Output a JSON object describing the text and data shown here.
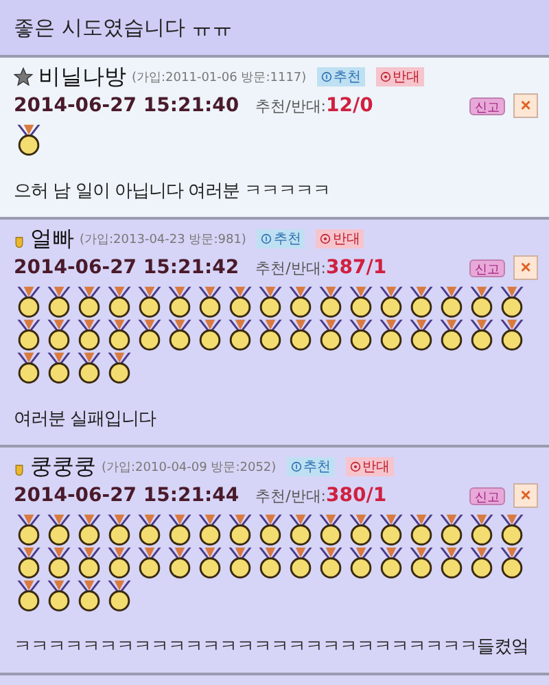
{
  "top_comment": {
    "text": "좋은 시도였습니다 ㅠㅠ"
  },
  "comments": [
    {
      "highlighted": false,
      "kind": "star",
      "name": "비닐나방",
      "info": "(가입:2011-01-06 방문:1117)",
      "recommend": "추천",
      "oppose": "반대",
      "datetime": "2014-06-27 15:21:40",
      "vote_label": "추천/반대:",
      "votes": "12/0",
      "report": "신고",
      "close": "×",
      "medals": [
        {
          "kind": "gold"
        }
      ],
      "text": "으허 남 일이 아닙니다 여러분 ㅋㅋㅋㅋㅋ"
    },
    {
      "highlighted": true,
      "kind": "badge",
      "name": "얼빠",
      "info": "(가입:2013-04-23 방문:981)",
      "recommend": "추천",
      "oppose": "반대",
      "datetime": "2014-06-27 15:21:42",
      "vote_label": "추천/반대:",
      "votes": "387/1",
      "report": "신고",
      "close": "×",
      "medals": [
        {
          "kind": "gold"
        },
        {
          "kind": "gold"
        },
        {
          "kind": "gold"
        },
        {
          "kind": "gold"
        },
        {
          "kind": "gold"
        },
        {
          "kind": "gold"
        },
        {
          "kind": "gold"
        },
        {
          "kind": "gold"
        },
        {
          "kind": "gold"
        },
        {
          "kind": "gold"
        },
        {
          "kind": "gold"
        },
        {
          "kind": "gold"
        },
        {
          "kind": "gold"
        },
        {
          "kind": "gold"
        },
        {
          "kind": "gold"
        },
        {
          "kind": "gold"
        },
        {
          "kind": "gold"
        },
        {
          "kind": "gold"
        },
        {
          "kind": "gold"
        },
        {
          "kind": "gold"
        },
        {
          "kind": "gold"
        },
        {
          "kind": "gold"
        },
        {
          "kind": "gold"
        },
        {
          "kind": "gold"
        },
        {
          "kind": "gold"
        },
        {
          "kind": "gold"
        },
        {
          "kind": "gold"
        },
        {
          "kind": "gold"
        },
        {
          "kind": "gold"
        },
        {
          "kind": "gold"
        },
        {
          "kind": "gold"
        },
        {
          "kind": "gold"
        },
        {
          "kind": "gold"
        },
        {
          "kind": "gold"
        },
        {
          "kind": "gold"
        },
        {
          "kind": "gold"
        },
        {
          "kind": "gold"
        },
        {
          "kind": "gold"
        }
      ],
      "text": "여러분 실패입니다"
    },
    {
      "highlighted": true,
      "kind": "badge",
      "name": "쿵쿵쿵",
      "info": "(가입:2010-04-09 방문:2052)",
      "recommend": "추천",
      "oppose": "반대",
      "datetime": "2014-06-27 15:21:44",
      "vote_label": "추천/반대:",
      "votes": "380/1",
      "report": "신고",
      "close": "×",
      "medals": [
        {
          "kind": "gold"
        },
        {
          "kind": "gold"
        },
        {
          "kind": "gold"
        },
        {
          "kind": "gold"
        },
        {
          "kind": "gold"
        },
        {
          "kind": "gold"
        },
        {
          "kind": "gold"
        },
        {
          "kind": "gold"
        },
        {
          "kind": "gold"
        },
        {
          "kind": "gold"
        },
        {
          "kind": "gold"
        },
        {
          "kind": "gold"
        },
        {
          "kind": "gold"
        },
        {
          "kind": "gold"
        },
        {
          "kind": "gold"
        },
        {
          "kind": "gold"
        },
        {
          "kind": "gold"
        },
        {
          "kind": "gold"
        },
        {
          "kind": "gold"
        },
        {
          "kind": "gold"
        },
        {
          "kind": "gold"
        },
        {
          "kind": "gold"
        },
        {
          "kind": "gold"
        },
        {
          "kind": "gold"
        },
        {
          "kind": "gold"
        },
        {
          "kind": "gold"
        },
        {
          "kind": "gold"
        },
        {
          "kind": "gold"
        },
        {
          "kind": "gold"
        },
        {
          "kind": "gold"
        },
        {
          "kind": "gold"
        },
        {
          "kind": "gold"
        },
        {
          "kind": "gold"
        },
        {
          "kind": "gold"
        },
        {
          "kind": "gold"
        },
        {
          "kind": "gold"
        },
        {
          "kind": "gold"
        },
        {
          "kind": "gold"
        }
      ],
      "text": "ㅋㅋㅋㅋㅋㅋㅋㅋㅋㅋㅋㅋㅋㅋㅋㅋㅋㅋㅋㅋㅋㅋㅋㅋㅋㅋㅋ들켰엌"
    }
  ]
}
